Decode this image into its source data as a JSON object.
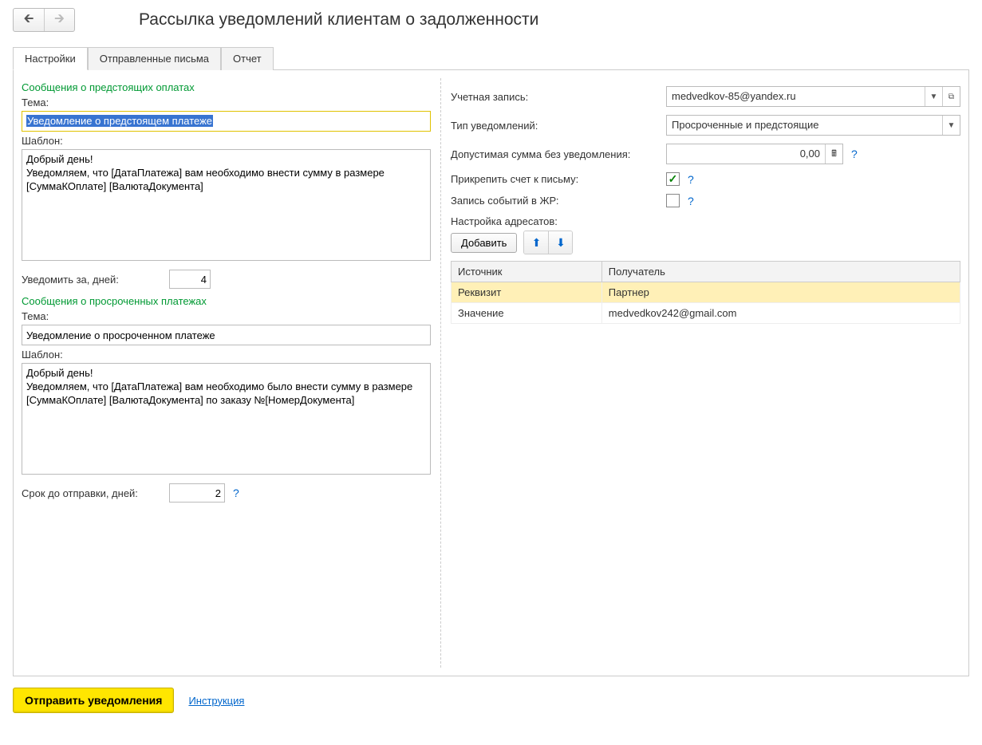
{
  "title": "Рассылка уведомлений клиентам о задолженности",
  "tabs": {
    "settings": "Настройки",
    "sent": "Отправленные письма",
    "report": "Отчет"
  },
  "left": {
    "upcoming": {
      "section": "Сообщения о предстоящих оплатах",
      "subject_label": "Тема:",
      "subject": "Уведомление о предстоящем платеже",
      "template_label": "Шаблон:",
      "template": "Добрый день!\nУведомляем, что [ДатаПлатежа] вам необходимо внести сумму в размере  [СуммаКОплате] [ВалютаДокумента]",
      "notify_days_label": "Уведомить за, дней:",
      "notify_days": "4"
    },
    "overdue": {
      "section": "Сообщения о просроченных платежах",
      "subject_label": "Тема:",
      "subject": "Уведомление о просроченном платеже",
      "template_label": "Шаблон:",
      "template": "Добрый день!\nУведомляем, что [ДатаПлатежа] вам необходимо было внести сумму в размере  [СуммаКОплате] [ВалютаДокумента] по заказу №[НомерДокумента]",
      "send_days_label": "Срок до отправки, дней:",
      "send_days": "2"
    }
  },
  "right": {
    "account_label": "Учетная запись:",
    "account": "medvedkov-85@yandex.ru",
    "type_label": "Тип уведомлений:",
    "type": "Просроченные и предстоящие",
    "threshold_label": "Допустимая сумма без уведомления:",
    "threshold": "0,00",
    "attach_label": "Прикрепить счет к письму:",
    "attach": true,
    "log_label": "Запись событий в ЖР:",
    "log": false,
    "recipients_label": "Настройка адресатов:",
    "add_btn": "Добавить",
    "grid": {
      "col1": "Источник",
      "col2": "Получатель",
      "rows": [
        {
          "c1": "Реквизит",
          "c2": "Партнер",
          "selected": true
        },
        {
          "c1": "Значение",
          "c2": "medvedkov242@gmail.com",
          "selected": false
        }
      ]
    }
  },
  "footer": {
    "send": "Отправить уведомления",
    "instruction": "Инструкция"
  }
}
